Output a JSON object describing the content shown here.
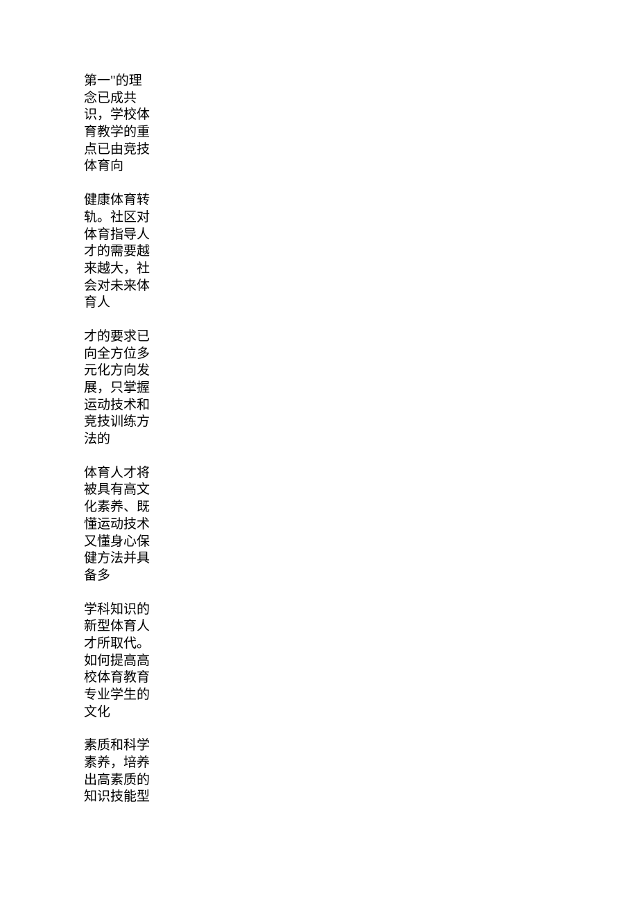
{
  "paragraphs": [
    "第一\"的理念已成共识，学校体育教学的重点已由竞技体育向",
    "健康体育转轨。社区对体育指导人才的需要越来越大，社会对未来体育人",
    "才的要求已向全方位多元化方向发展，只掌握运动技术和竞技训练方法的",
    "体育人才将被具有高文化素养、既懂运动技术又懂身心保健方法并具备多",
    "学科知识的新型体育人才所取代。如何提高高校体育教育专业学生的文化",
    "素质和科学素养，培养出高素质的知识技能型"
  ]
}
